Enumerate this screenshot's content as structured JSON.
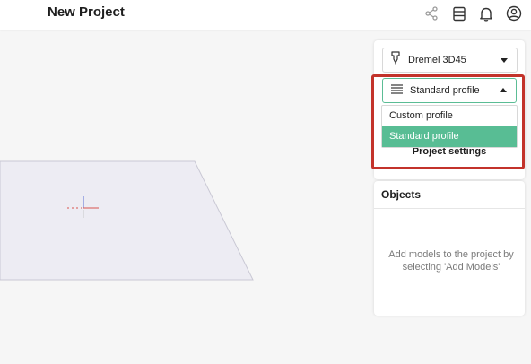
{
  "header": {
    "title": "New Project",
    "icons": [
      "share-icon",
      "library-icon",
      "notifications-icon",
      "account-icon"
    ]
  },
  "printer": {
    "selected": "Dremel 3D45",
    "icon": "nozzle-icon"
  },
  "profile": {
    "selected": "Standard profile",
    "icon": "profile-list-icon",
    "expanded": true,
    "options": [
      "Custom profile",
      "Standard profile"
    ],
    "selected_index": 1
  },
  "settings": {
    "button_label": "Project settings"
  },
  "objects": {
    "title": "Objects",
    "empty_message": "Add models to the project by selecting 'Add Models'"
  },
  "colors": {
    "accent": "#58bd94",
    "highlight": "#c3332b"
  }
}
